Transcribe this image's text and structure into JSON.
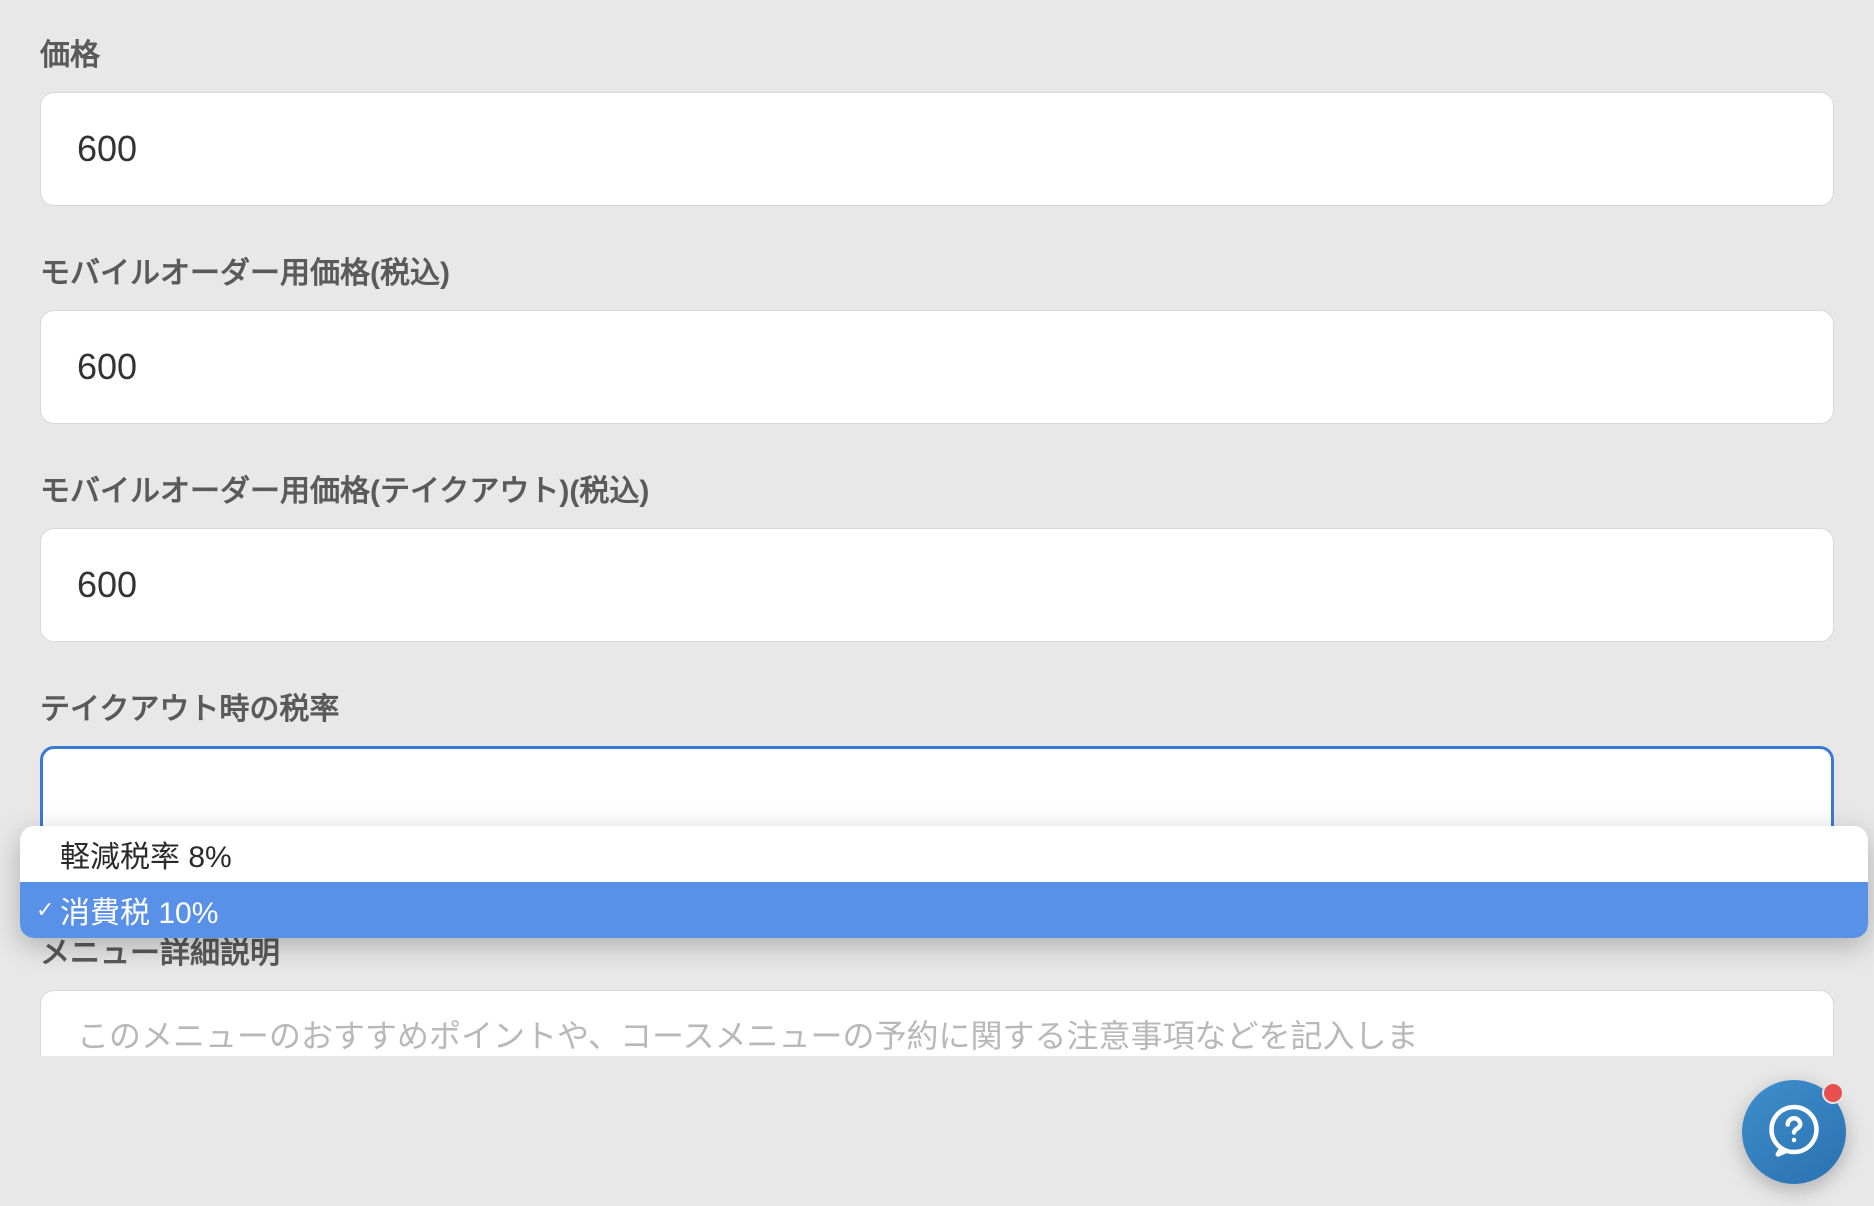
{
  "fields": {
    "price": {
      "label": "価格",
      "value": "600"
    },
    "mobile_order_price": {
      "label": "モバイルオーダー用価格(税込)",
      "value": "600"
    },
    "mobile_order_takeout_price": {
      "label": "モバイルオーダー用価格(テイクアウト)(税込)",
      "value": "600"
    },
    "takeout_tax_rate": {
      "label": "テイクアウト時の税率",
      "options": [
        {
          "label": "軽減税率 8%",
          "selected": false
        },
        {
          "label": "消費税 10%",
          "selected": true
        }
      ]
    },
    "menu_detail": {
      "label": "メニュー詳細説明",
      "placeholder": "このメニューのおすすめポイントや、コースメニューの予約に関する注意事項などを記入しま"
    }
  }
}
